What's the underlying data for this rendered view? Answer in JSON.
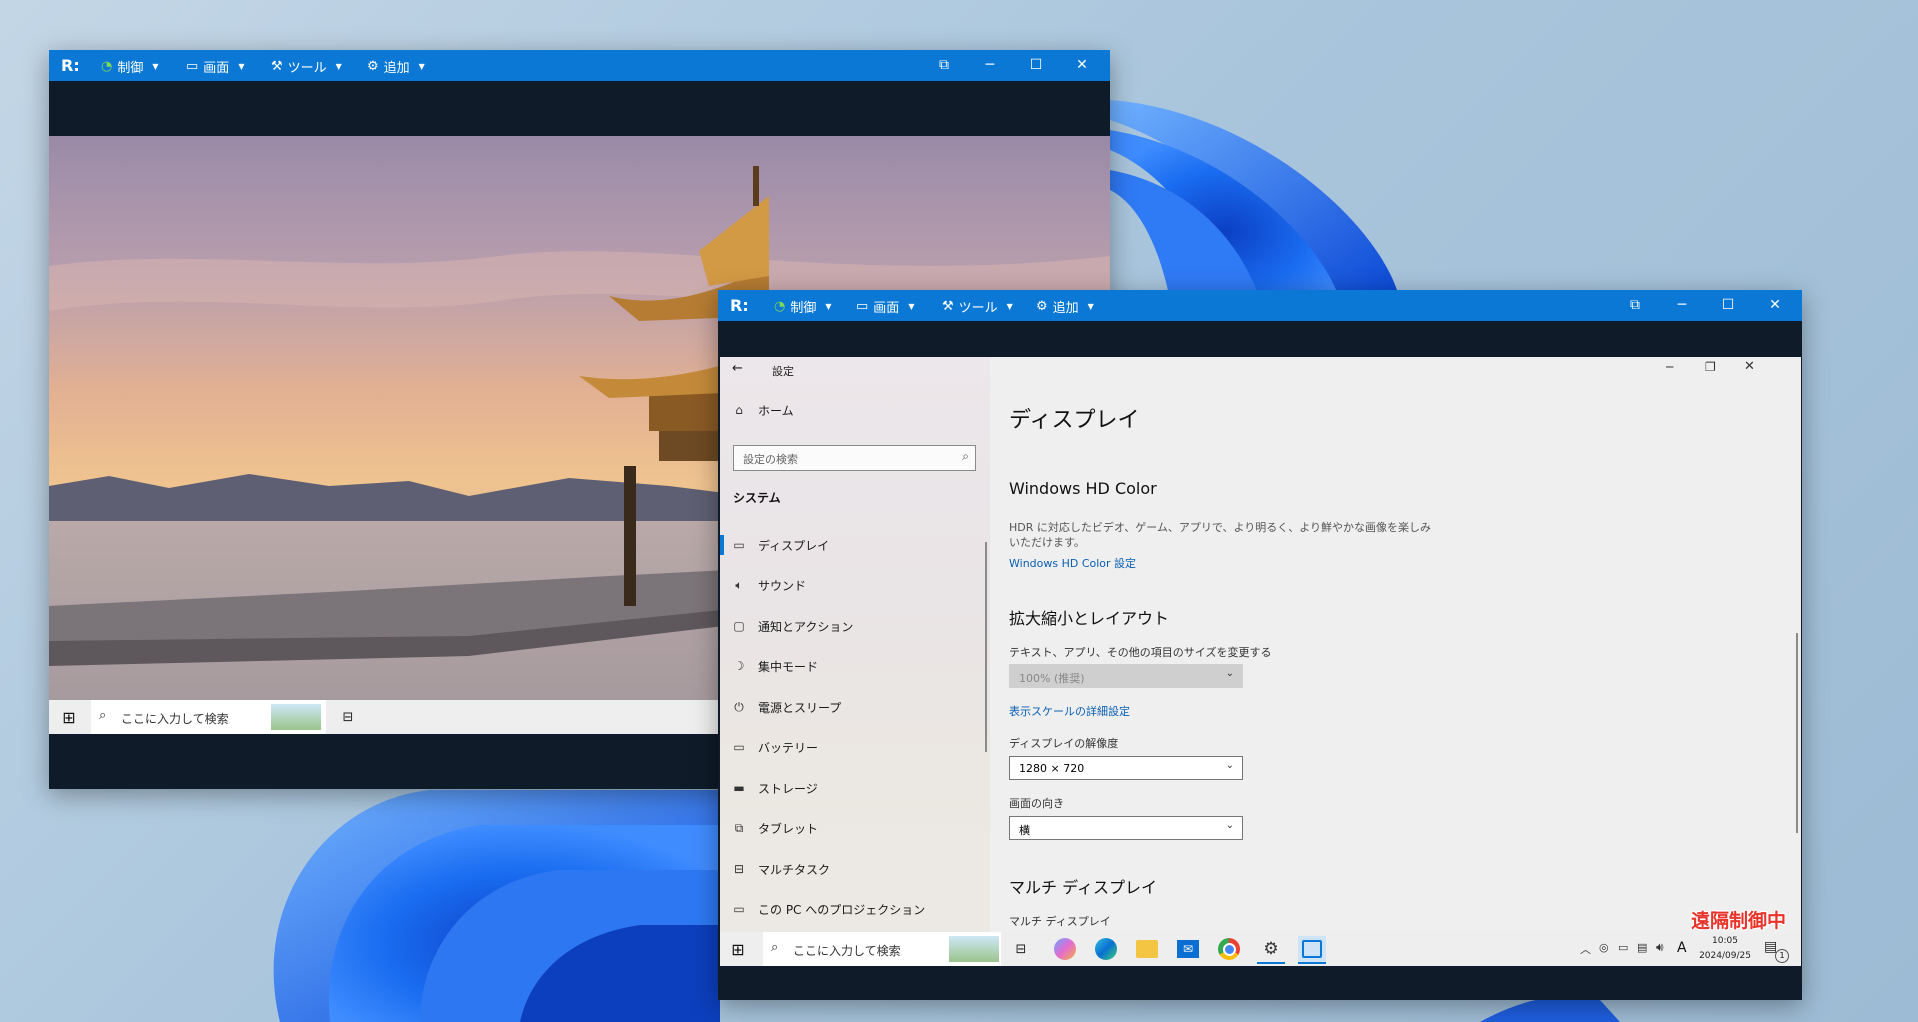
{
  "remote_toolbar": {
    "logo": "R:",
    "menus": [
      {
        "label": "制御",
        "icon": "control-icon"
      },
      {
        "label": "画面",
        "icon": "monitor-icon"
      },
      {
        "label": "ツール",
        "icon": "wrench-icon"
      },
      {
        "label": "追加",
        "icon": "gear-icon"
      }
    ]
  },
  "back_taskbar": {
    "search_placeholder": "ここに入力して検索"
  },
  "settings": {
    "window_title": "設定",
    "home": "ホーム",
    "search_placeholder": "設定の検索",
    "section": "システム",
    "nav": [
      {
        "label": "ディスプレイ",
        "icon": "display-icon",
        "selected": true
      },
      {
        "label": "サウンド",
        "icon": "speaker-icon"
      },
      {
        "label": "通知とアクション",
        "icon": "notification-icon"
      },
      {
        "label": "集中モード",
        "icon": "moon-icon"
      },
      {
        "label": "電源とスリープ",
        "icon": "power-icon"
      },
      {
        "label": "バッテリー",
        "icon": "battery-icon"
      },
      {
        "label": "ストレージ",
        "icon": "storage-icon"
      },
      {
        "label": "タブレット",
        "icon": "tablet-icon"
      },
      {
        "label": "マルチタスク",
        "icon": "multitask-icon"
      },
      {
        "label": "この PC へのプロジェクション",
        "icon": "projection-icon"
      }
    ],
    "page_title": "ディスプレイ",
    "hdr_heading": "Windows HD Color",
    "hdr_desc_1": "HDR に対応したビデオ、ゲーム、アプリで、より明るく、より鮮やかな画像を楽しみ",
    "hdr_desc_2": "いただけます。",
    "hdr_link": "Windows HD Color 設定",
    "scale_heading": "拡大縮小とレイアウト",
    "scale_label": "テキスト、アプリ、その他の項目のサイズを変更する",
    "scale_value": "100% (推奨)",
    "scale_link": "表示スケールの詳細設定",
    "resolution_label": "ディスプレイの解像度",
    "resolution_value": "1280 × 720",
    "orientation_label": "画面の向き",
    "orientation_value": "横",
    "multi_heading": "マルチ ディスプレイ",
    "multi_label": "マルチ ディスプレイ"
  },
  "front_taskbar": {
    "search_placeholder": "ここに入力して検索",
    "time": "10:05",
    "date": "2024/09/25",
    "ime": "A",
    "notification_count": "1"
  },
  "remote_badge": "遠隔制御中",
  "colors": {
    "accent": "#0a78d4",
    "badge": "#e8342a",
    "link": "#0a5fb4"
  }
}
